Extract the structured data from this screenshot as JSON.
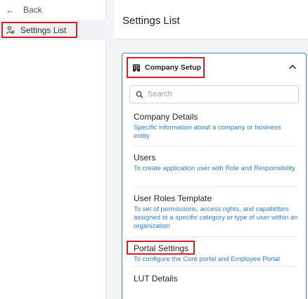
{
  "sidebar": {
    "back_label": "Back",
    "active_item": "Settings List"
  },
  "header": {
    "title": "Settings List"
  },
  "section": {
    "title": "Company Setup",
    "search_placeholder": "Search",
    "items": [
      {
        "title": "Company Details",
        "desc": "Specific information about a company or business entity"
      },
      {
        "title": "Users",
        "desc": "To create application user with Role and Responsibility"
      },
      {
        "title": "User Roles Template",
        "desc": "To set of permissions, access rights, and capabilities assigned to a specific category or type of user within an organization"
      },
      {
        "title": "Portal Settings",
        "desc": "To configure the Core portal and Employee Portal"
      },
      {
        "title": "LUT Details",
        "desc": ""
      }
    ]
  },
  "colors": {
    "accent": "#2f7fd8",
    "highlight": "#d81e2a",
    "card_border": "#3e86d6"
  }
}
